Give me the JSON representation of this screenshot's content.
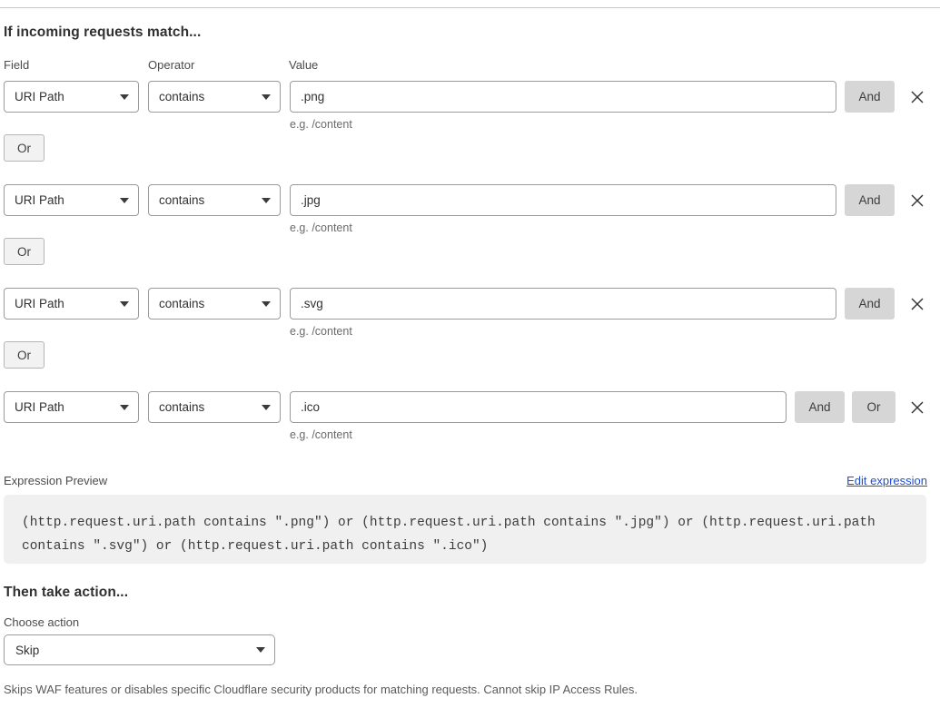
{
  "section_match": {
    "heading": "If incoming requests match...",
    "column_labels": {
      "field": "Field",
      "operator": "Operator",
      "value": "Value"
    },
    "value_hint": "e.g. /content",
    "or_connector_label": "Or",
    "rows": [
      {
        "field": "URI Path",
        "operator": "contains",
        "value": ".png",
        "hint": "e.g. /content",
        "and_label": "And",
        "or_label": "Or",
        "show_or_button": false
      },
      {
        "field": "URI Path",
        "operator": "contains",
        "value": ".jpg",
        "hint": "e.g. /content",
        "and_label": "And",
        "or_label": "Or",
        "show_or_button": false
      },
      {
        "field": "URI Path",
        "operator": "contains",
        "value": ".svg",
        "hint": "e.g. /content",
        "and_label": "And",
        "or_label": "Or",
        "show_or_button": false
      },
      {
        "field": "URI Path",
        "operator": "contains",
        "value": ".ico",
        "hint": "e.g. /content",
        "and_label": "And",
        "or_label": "Or",
        "show_or_button": true
      }
    ]
  },
  "expression": {
    "label": "Expression Preview",
    "edit_link": "Edit expression",
    "text": "(http.request.uri.path contains \".png\") or (http.request.uri.path contains \".jpg\") or (http.request.uri.path contains \".svg\") or (http.request.uri.path contains \".ico\")"
  },
  "section_action": {
    "heading": "Then take action...",
    "choose_action_label": "Choose action",
    "selected_action": "Skip",
    "help_text": "Skips WAF features or disables specific Cloudflare security products for matching requests. Cannot skip IP Access Rules."
  },
  "icons": {
    "remove": "close-icon",
    "dropdown": "chevron-down-icon"
  },
  "colors": {
    "link": "#1d4ed8",
    "button_gray": "#d6d6d6",
    "panel_gray": "#f0f0f0",
    "border": "#9a9a9a"
  }
}
